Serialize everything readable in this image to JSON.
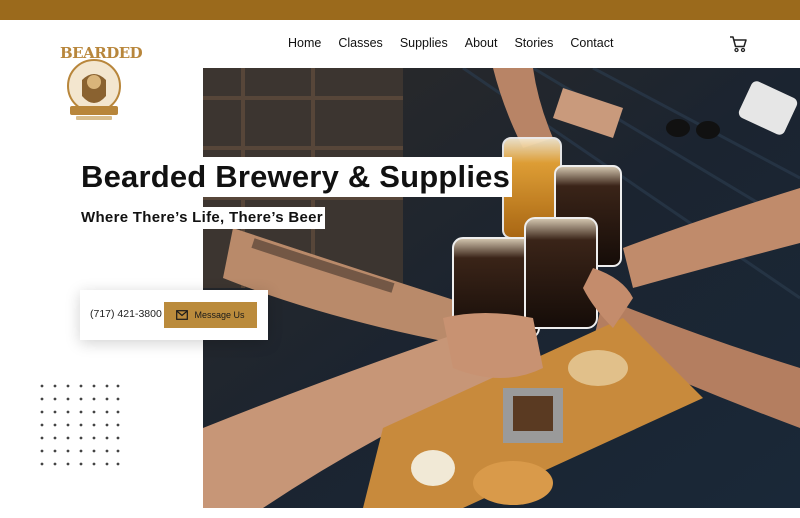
{
  "colors": {
    "top_bar": "#9b6a1c",
    "accent": "#bb8b3c",
    "logo": "#b8863b"
  },
  "logo": {
    "text": "BEARDED",
    "icon": "bearded-man-badge-icon"
  },
  "nav": {
    "items": [
      {
        "label": "Home"
      },
      {
        "label": "Classes"
      },
      {
        "label": "Supplies"
      },
      {
        "label": "About"
      },
      {
        "label": "Stories"
      },
      {
        "label": "Contact"
      }
    ]
  },
  "cart": {
    "icon": "cart-icon"
  },
  "hero": {
    "title": "Bearded Brewery & Supplies",
    "subtitle": "Where There’s Life, There’s Beer",
    "image": "people-toasting-beer-glasses-photo"
  },
  "contact": {
    "phone": "(717) 421-3800",
    "button_label": "Message Us",
    "button_icon": "mail-icon"
  }
}
